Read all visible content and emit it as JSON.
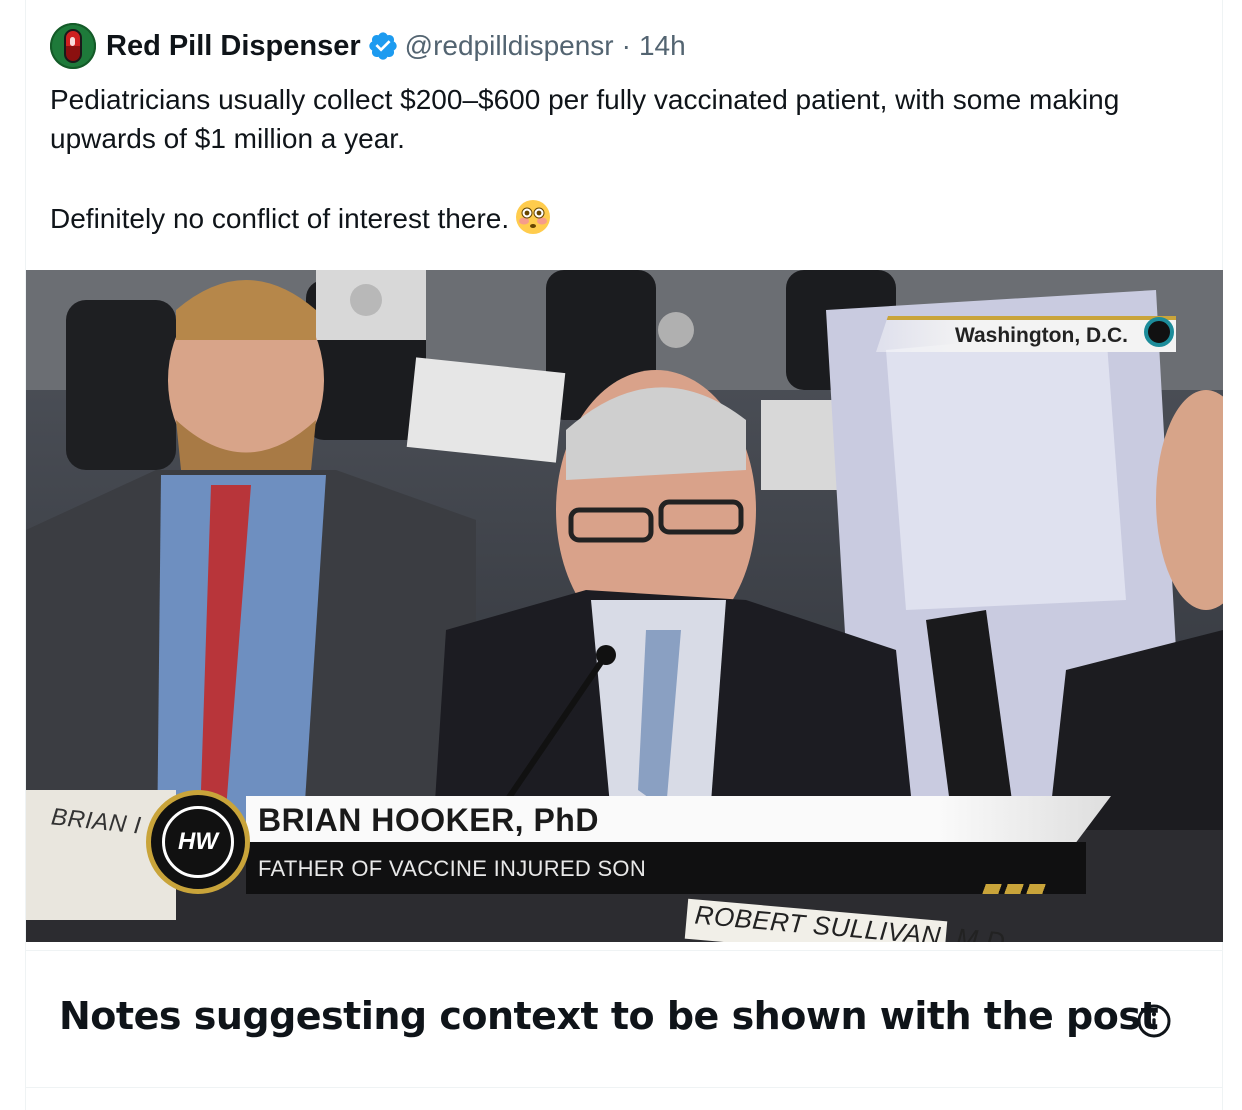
{
  "post": {
    "author_name": "Red Pill Dispenser",
    "handle": "@redpilldispensr",
    "separator": "·",
    "time": "14h",
    "text_line1": "Pediatricians usually collect $200–$600 per fully vaccinated patient, with some making upwards of $1 million a year.",
    "text_line2": "Definitely no conflict of interest there.",
    "emoji": "flushed-face-emoji"
  },
  "media": {
    "location": "Washington, D.C.",
    "lower_third_name": "BRIAN HOOKER, PhD",
    "lower_third_subtitle": "FATHER OF VACCINE INJURED SON",
    "logo_text": "HW",
    "placard_left": "BRIAN I",
    "placard_right": "ROBERT SULLIVAN, M.D."
  },
  "notes": {
    "heading": "Notes suggesting context to be shown with the post",
    "icon": "info-icon"
  },
  "colors": {
    "verified_blue": "#1d9bf0",
    "text_primary": "#0f1419",
    "text_secondary": "#536471",
    "gold_accent": "#c9a43a"
  }
}
